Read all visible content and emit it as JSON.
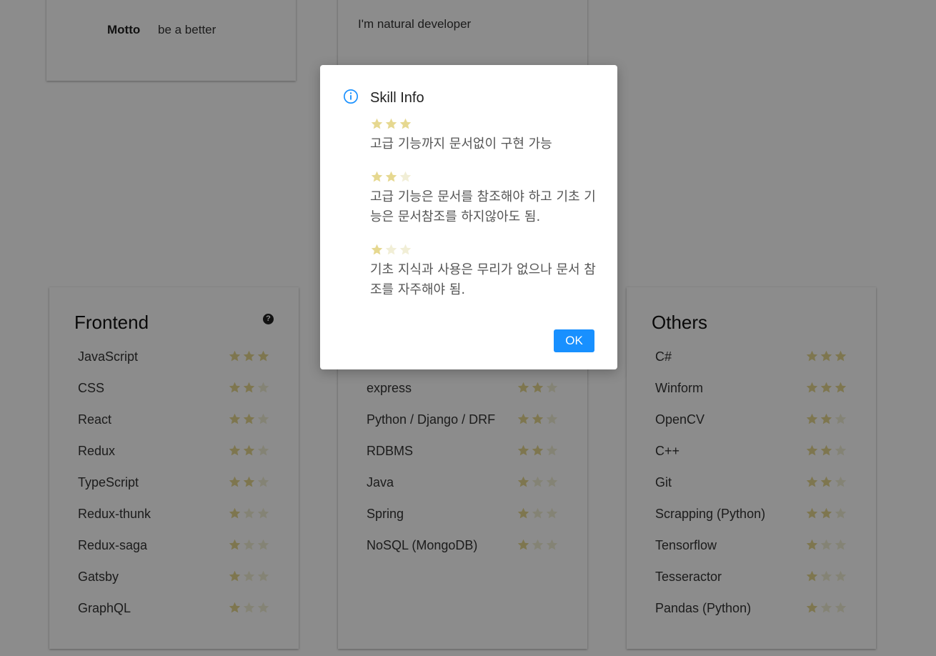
{
  "profile": {
    "motto_label": "Motto",
    "motto_value": "be a better",
    "bio": "I'm natural developer"
  },
  "colors": {
    "star_on": "#e6d890",
    "star_off": "#f1eed6",
    "ok_button": "#1890ff"
  },
  "skills": {
    "frontend": {
      "title": "Frontend",
      "help_icon": "question-circle-icon",
      "items": [
        {
          "name": "JavaScript",
          "rating": 3
        },
        {
          "name": "CSS",
          "rating": 2
        },
        {
          "name": "React",
          "rating": 2
        },
        {
          "name": "Redux",
          "rating": 2
        },
        {
          "name": "TypeScript",
          "rating": 2
        },
        {
          "name": "Redux-thunk",
          "rating": 1
        },
        {
          "name": "Redux-saga",
          "rating": 1
        },
        {
          "name": "Gatsby",
          "rating": 1
        },
        {
          "name": "GraphQL",
          "rating": 1
        }
      ]
    },
    "backend": {
      "title": "",
      "items": [
        {
          "name": "express",
          "rating": 2
        },
        {
          "name": "Python / Django / DRF",
          "rating": 2
        },
        {
          "name": "RDBMS",
          "rating": 2
        },
        {
          "name": "Java",
          "rating": 1
        },
        {
          "name": "Spring",
          "rating": 1
        },
        {
          "name": "NoSQL (MongoDB)",
          "rating": 1
        }
      ]
    },
    "others": {
      "title": "Others",
      "items": [
        {
          "name": "C#",
          "rating": 3
        },
        {
          "name": "Winform",
          "rating": 3
        },
        {
          "name": "OpenCV",
          "rating": 2
        },
        {
          "name": "C++",
          "rating": 2
        },
        {
          "name": "Git",
          "rating": 2
        },
        {
          "name": "Scrapping (Python)",
          "rating": 2
        },
        {
          "name": "Tensorflow",
          "rating": 1
        },
        {
          "name": "Tesseractor",
          "rating": 1
        },
        {
          "name": "Pandas (Python)",
          "rating": 1
        }
      ]
    }
  },
  "modal": {
    "title": "Skill Info",
    "icon": "info-circle-icon",
    "levels": [
      {
        "rating": 3,
        "text": "고급 기능까지 문서없이 구현 가능"
      },
      {
        "rating": 2,
        "text": "고급 기능은 문서를 참조해야 하고 기초 기능은 문서참조를 하지않아도 됨."
      },
      {
        "rating": 1,
        "text": "기초 지식과 사용은 무리가 없으나 문서 참조를 자주해야 됨."
      }
    ],
    "ok_label": "OK"
  }
}
